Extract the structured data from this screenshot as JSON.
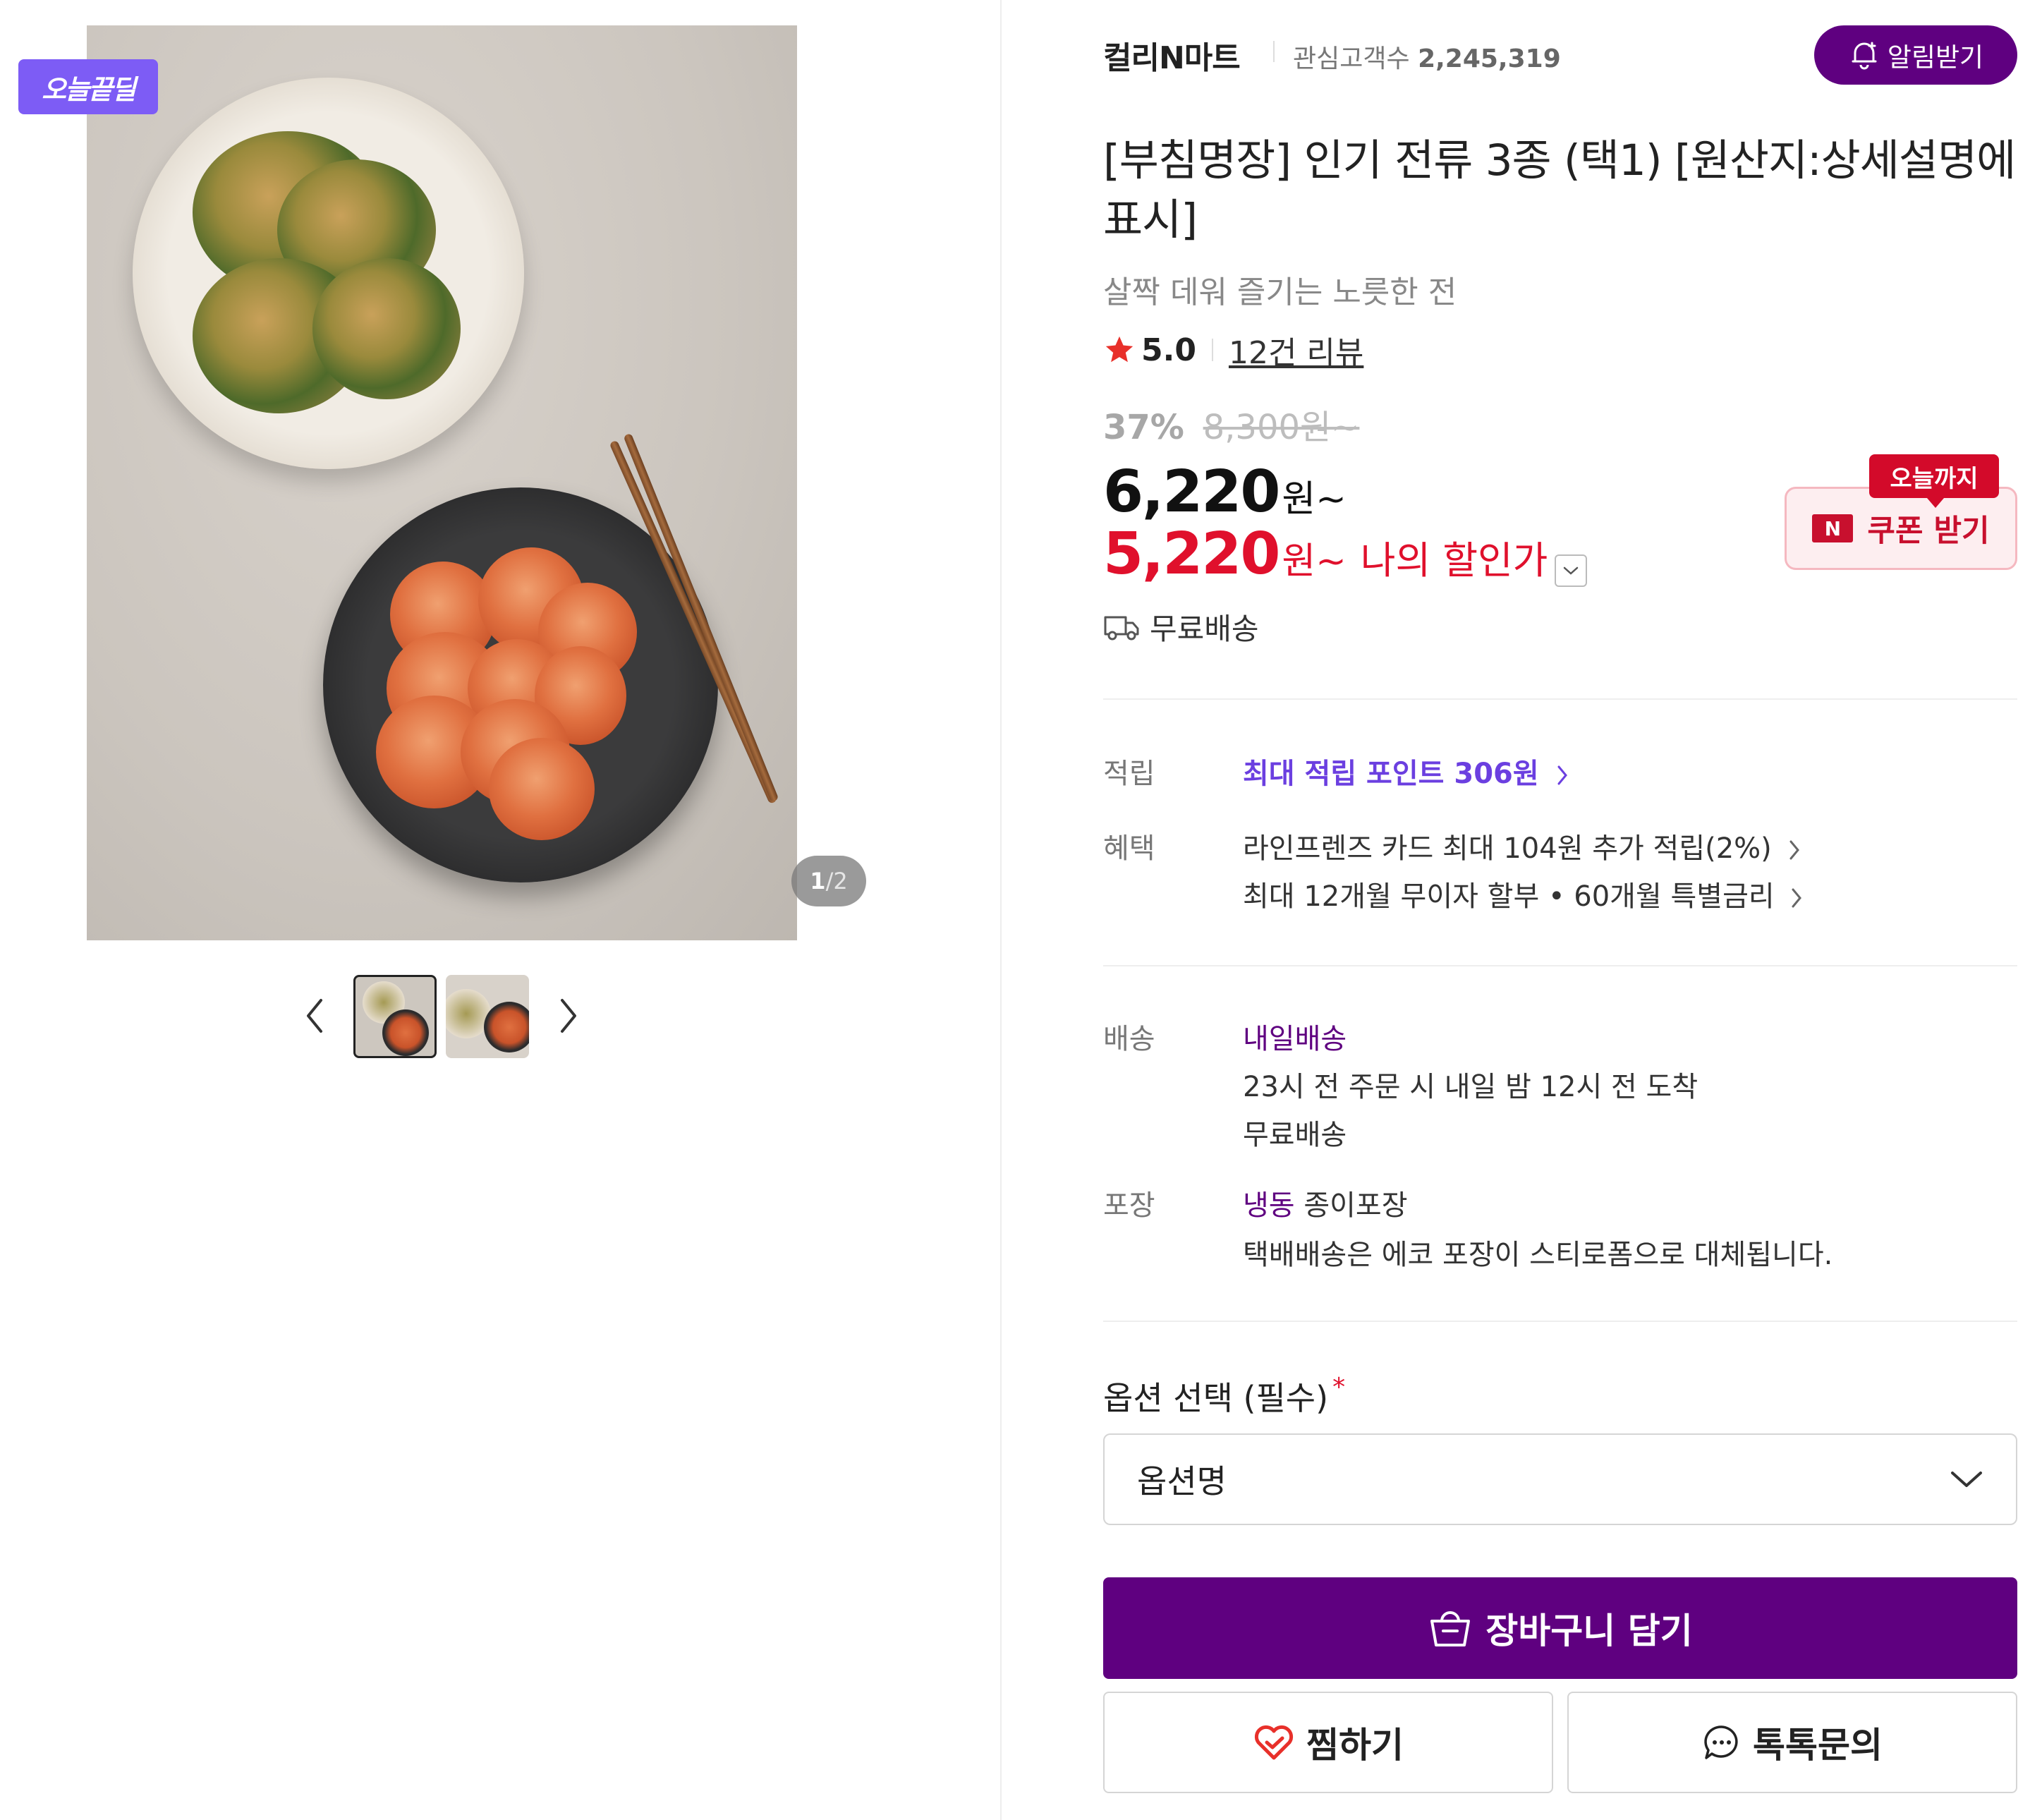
{
  "gallery": {
    "badge": "오늘끝딜",
    "counter_current": "1",
    "counter_total": "/2"
  },
  "seller": {
    "name": "컬리N마트",
    "followers_label": "관심고객수",
    "followers_count": "2,245,319",
    "alert_button": "알림받기"
  },
  "product": {
    "title": "[부침명장] 인기 전류 3종 (택1) [원산지:상세설명에 표시]",
    "subtitle": "살짝 데워 즐기는 노릇한 전",
    "rating": "5.0",
    "reviews": "12건 리뷰",
    "discount_rate": "37%",
    "original_price": "8,300원~",
    "price": "6,220",
    "price_unit": "원~",
    "my_price": "5,220",
    "my_price_unit": "원~",
    "my_price_label": "나의 할인가",
    "shipping_badge": "무료배송"
  },
  "coupon": {
    "tag": "오늘까지",
    "badge": "N",
    "label": "쿠폰 받기"
  },
  "details": {
    "points_key": "적립",
    "points_value": "최대 적립 포인트 306원",
    "benefit_key": "혜택",
    "benefit_1": "라인프렌즈 카드 최대 104원 추가 적립(2%)",
    "benefit_2": "최대 12개월 무이자 할부 • 60개월 특별금리",
    "delivery_key": "배송",
    "delivery_type": "내일배송",
    "delivery_time": "23시 전 주문 시 내일 밤 12시 전 도착",
    "delivery_fee": "무료배송",
    "package_key": "포장",
    "package_type_colored": "냉동",
    "package_type_rest": "종이포장",
    "package_note": "택배배송은 에코 포장이 스티로폼으로 대체됩니다."
  },
  "option": {
    "label": "옵션 선택 (필수)",
    "required_mark": "*",
    "placeholder": "옵션명"
  },
  "actions": {
    "cart": "장바구니 담기",
    "wish": "찜하기",
    "talk": "톡톡문의"
  },
  "colors": {
    "brand_purple": "#5f0080",
    "price_red": "#e0102c",
    "point_violet": "#6b3fe0"
  }
}
